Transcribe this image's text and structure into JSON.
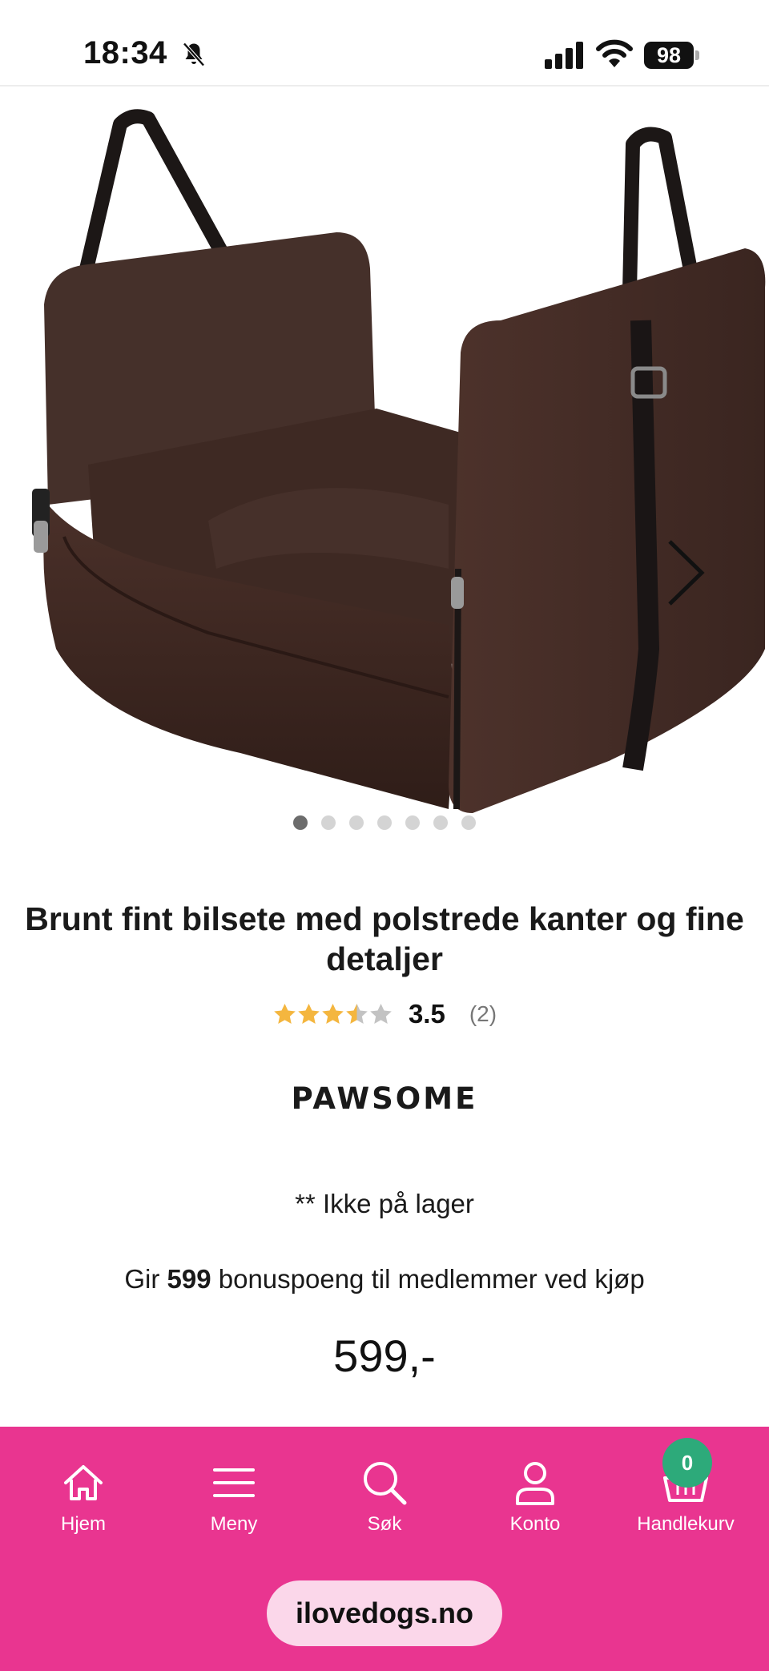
{
  "status_bar": {
    "time": "18:34",
    "battery": "98",
    "icons": [
      "bell-slash-icon",
      "signal-icon",
      "wifi-icon",
      "battery-icon"
    ]
  },
  "gallery": {
    "image": "brown-dog-car-seat",
    "slide_count": 7,
    "active_slide": 1,
    "next_icon": "chevron-right-icon"
  },
  "product": {
    "title": "Brunt fint bilsete med polstrede kanter og fine detaljer",
    "rating_value": "3.5",
    "rating_count": "(2)",
    "rating_score": 3.5,
    "rating_max": 5,
    "brand": "PAWSOME",
    "stock_status": "** Ikke på lager",
    "bonus_prefix": "Gir",
    "bonus_points": "599",
    "bonus_suffix": "bonuspoeng til medlemmer ved kjøp",
    "price": "599,-"
  },
  "colors": {
    "nav_background": "#e93590",
    "star_filled": "#f4b63f",
    "star_empty": "#c3c3c3",
    "badge": "#2daa7a",
    "url_pill": "#fbd7ea"
  },
  "bottom_nav": {
    "items": [
      {
        "label": "Hjem",
        "icon": "home-icon"
      },
      {
        "label": "Meny",
        "icon": "menu-icon"
      },
      {
        "label": "Søk",
        "icon": "search-icon"
      },
      {
        "label": "Konto",
        "icon": "user-icon"
      },
      {
        "label": "Handlekurv",
        "icon": "basket-icon"
      }
    ],
    "cart_count": "0",
    "site_url": "ilovedogs.no"
  }
}
